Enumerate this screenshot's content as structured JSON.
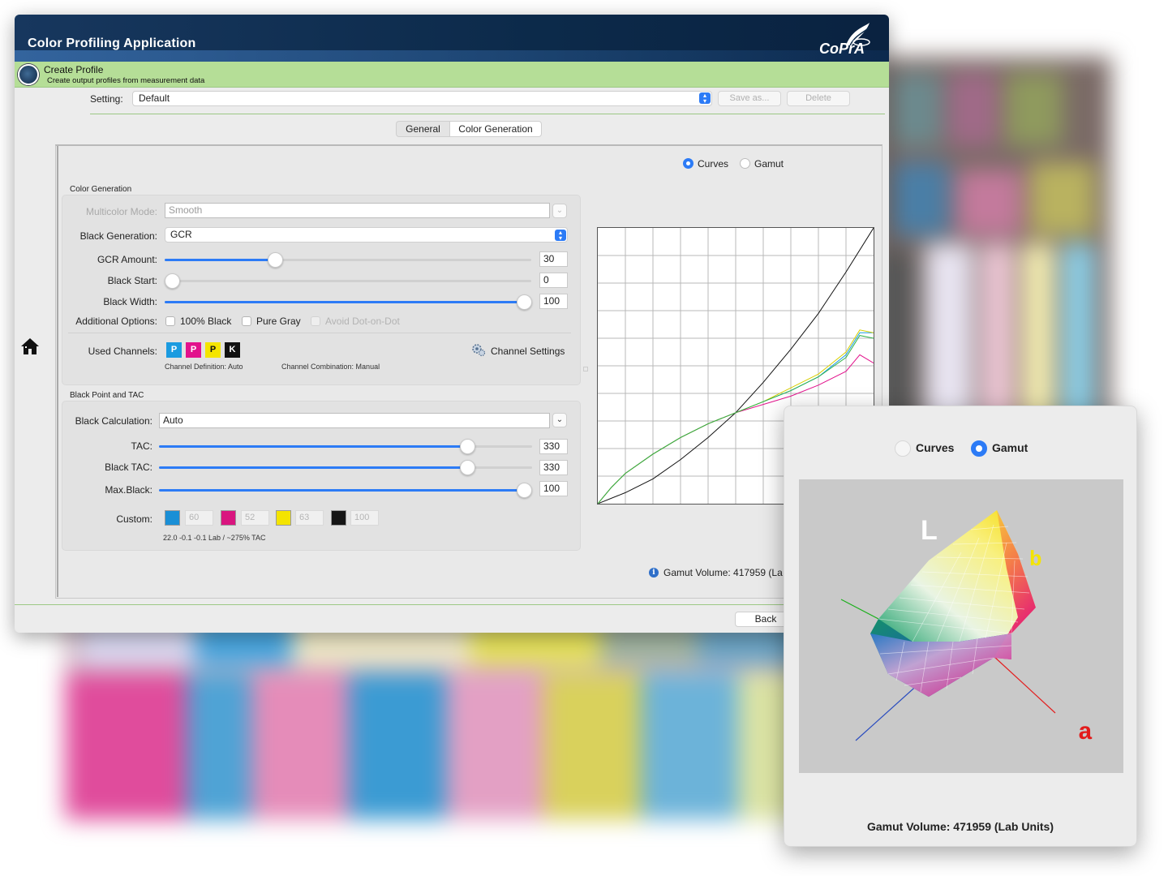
{
  "app": {
    "title": "Color Profiling Application",
    "brand": "CoPrA"
  },
  "header": {
    "title": "Create Profile",
    "subtitle": "Create output profiles from measurement data"
  },
  "setting": {
    "label": "Setting:",
    "value": "Default",
    "save_as": "Save as...",
    "delete": "Delete"
  },
  "tabs": [
    {
      "label": "General",
      "selected": false
    },
    {
      "label": "Color Generation",
      "selected": true
    }
  ],
  "view_mode": {
    "options": [
      "Curves",
      "Gamut"
    ],
    "selected": "Curves"
  },
  "color_generation": {
    "section_title": "Color Generation",
    "multicolor_mode": {
      "label": "Multicolor Mode:",
      "value": "Smooth"
    },
    "black_generation": {
      "label": "Black Generation:",
      "value": "GCR"
    },
    "gcr_amount": {
      "label": "GCR Amount:",
      "value": 30,
      "max": 100
    },
    "black_start": {
      "label": "Black Start:",
      "value": 0,
      "max": 100
    },
    "black_width": {
      "label": "Black Width:",
      "value": 100,
      "max": 100
    },
    "additional_options": {
      "label": "Additional Options:",
      "items": [
        {
          "label": "100% Black",
          "checked": false,
          "enabled": true
        },
        {
          "label": "Pure Gray",
          "checked": false,
          "enabled": true
        },
        {
          "label": "Avoid Dot-on-Dot",
          "checked": false,
          "enabled": false
        }
      ]
    },
    "used_channels": {
      "label": "Used Channels:",
      "channels": [
        {
          "letter": "P",
          "color": "#1a9be0"
        },
        {
          "letter": "P",
          "color": "#e2128c"
        },
        {
          "letter": "P",
          "color": "#f4e500"
        },
        {
          "letter": "K",
          "color": "#111111"
        }
      ],
      "channel_definition": "Channel Definition:  Auto",
      "channel_combination": "Channel Combination:  Manual",
      "settings_button": "Channel Settings"
    }
  },
  "black_point": {
    "section_title": "Black Point and TAC",
    "black_calculation": {
      "label": "Black Calculation:",
      "value": "Auto"
    },
    "tac": {
      "label": "TAC:",
      "value": 330,
      "max": 400
    },
    "black_tac": {
      "label": "Black TAC:",
      "value": 330,
      "max": 400
    },
    "max_black": {
      "label": "Max.Black:",
      "value": 100,
      "max": 100
    },
    "custom": {
      "label": "Custom:",
      "swatches": [
        {
          "color": "#1a8fd6",
          "value": "60"
        },
        {
          "color": "#d9157f",
          "value": "52"
        },
        {
          "color": "#f4e400",
          "value": "63"
        },
        {
          "color": "#151515",
          "value": "100"
        }
      ],
      "summary": "22.0 -0.1 -0.1 Lab / ~275% TAC"
    }
  },
  "chart_data": {
    "type": "line",
    "title": "",
    "xlabel": "",
    "ylabel": "",
    "xlim": [
      0,
      100
    ],
    "ylim": [
      0,
      100
    ],
    "grid": true,
    "series": [
      {
        "color": "#111111",
        "x": [
          0,
          10,
          20,
          30,
          40,
          50,
          60,
          70,
          80,
          90,
          100
        ],
        "y": [
          0,
          4,
          9,
          16,
          24,
          33,
          44,
          56,
          69,
          84,
          100
        ]
      },
      {
        "color": "#1a9be0",
        "x": [
          0,
          5,
          10,
          20,
          30,
          40,
          50,
          60,
          70,
          80,
          90,
          95,
          100
        ],
        "y": [
          0,
          6,
          11,
          18,
          24,
          29,
          33,
          37,
          41,
          46,
          54,
          62,
          62
        ]
      },
      {
        "color": "#e2128c",
        "x": [
          0,
          5,
          10,
          20,
          30,
          40,
          50,
          60,
          70,
          80,
          90,
          95,
          100
        ],
        "y": [
          0,
          6,
          11,
          18,
          24,
          29,
          33,
          36,
          39,
          43,
          48,
          54,
          51
        ]
      },
      {
        "color": "#d8cf00",
        "x": [
          0,
          5,
          10,
          20,
          30,
          40,
          50,
          60,
          70,
          80,
          90,
          95,
          100
        ],
        "y": [
          0,
          6,
          11,
          18,
          24,
          29,
          33,
          37,
          42,
          47,
          55,
          63,
          62
        ]
      },
      {
        "color": "#2fb34a",
        "x": [
          0,
          5,
          10,
          20,
          30,
          40,
          50,
          60,
          70,
          80,
          90,
          95,
          100
        ],
        "y": [
          0,
          6,
          11,
          18,
          24,
          29,
          33,
          37,
          41,
          46,
          53,
          61,
          60
        ]
      }
    ]
  },
  "gamut_main": {
    "label": "Gamut Volume: 417959 (La"
  },
  "footer": {
    "back": "Back"
  },
  "gamut_window": {
    "options": [
      "Curves",
      "Gamut"
    ],
    "selected": "Gamut",
    "axis_L": "L",
    "axis_a": "a",
    "axis_b": "b",
    "volume": "Gamut Volume: 471959 (Lab Units)"
  }
}
